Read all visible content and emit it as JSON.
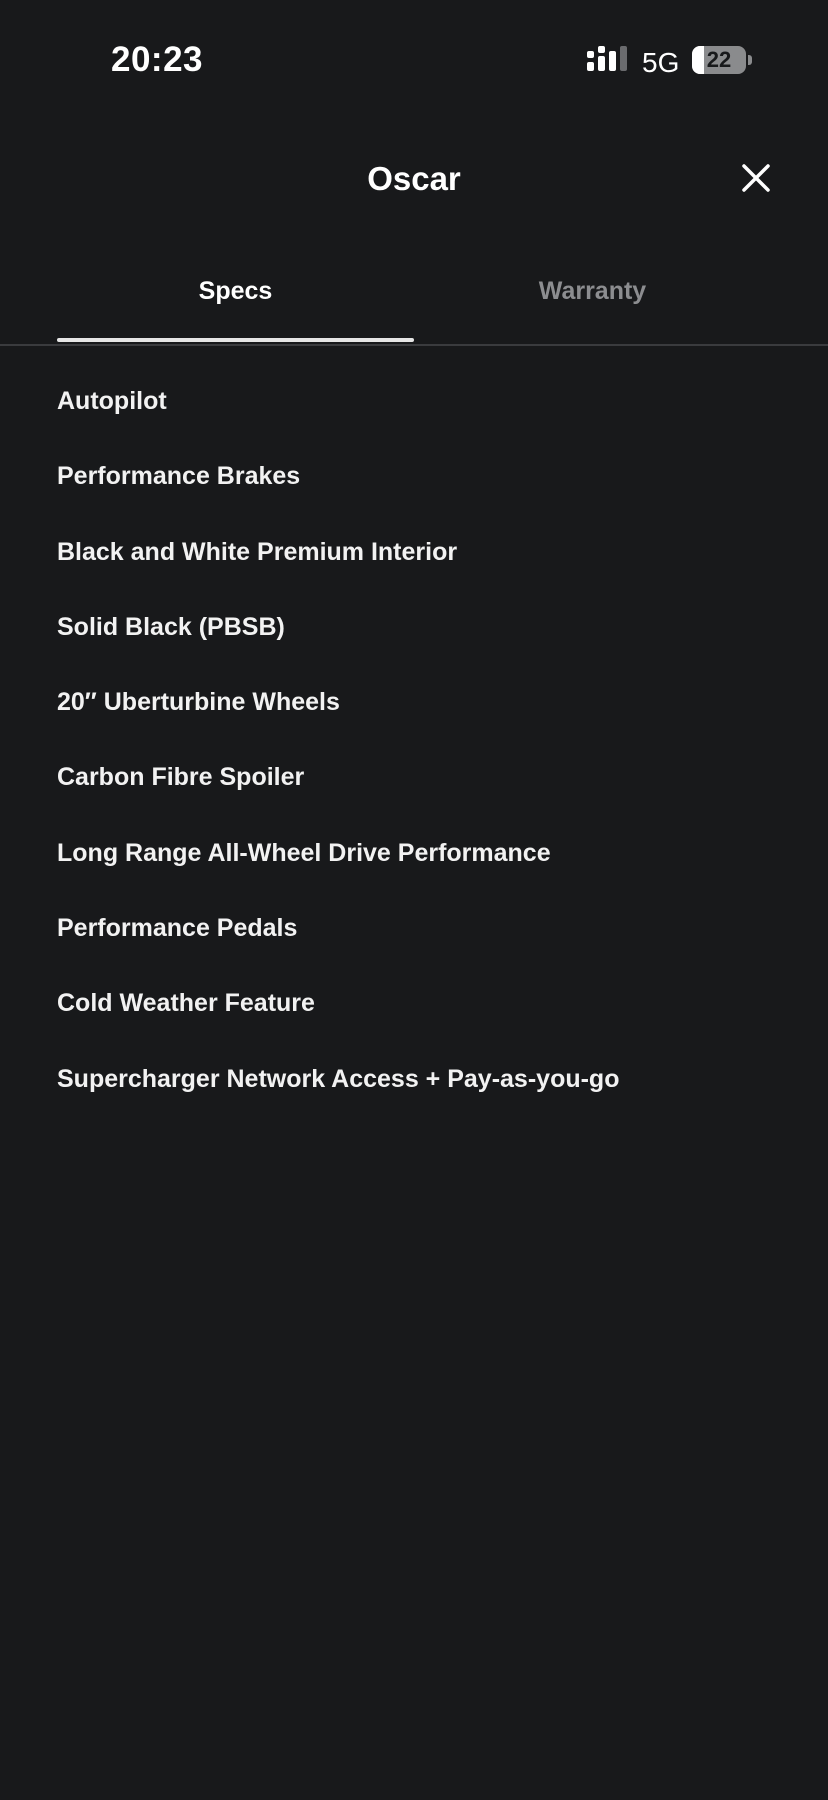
{
  "status_bar": {
    "time": "20:23",
    "network": "5G",
    "battery_level": "22",
    "battery_fraction": 0.22,
    "signal_icon": "signal-bars-icon"
  },
  "header": {
    "title": "Oscar",
    "close_icon": "close-icon"
  },
  "tabs": [
    {
      "label": "Specs",
      "active": true
    },
    {
      "label": "Warranty",
      "active": false
    }
  ],
  "specs": [
    "Autopilot",
    "Performance Brakes",
    "Black and White Premium Interior",
    "Solid Black (PBSB)",
    "20′′ Uberturbine Wheels",
    "Carbon Fibre Spoiler",
    "Long Range All-Wheel Drive Performance",
    "Performance Pedals",
    "Cold Weather Feature",
    "Supercharger Network Access + Pay-as-you-go"
  ],
  "colors": {
    "background": "#18191b",
    "text": "#ffffff",
    "tab_inactive": "#8c8d90",
    "divider": "#3a3b3e"
  }
}
